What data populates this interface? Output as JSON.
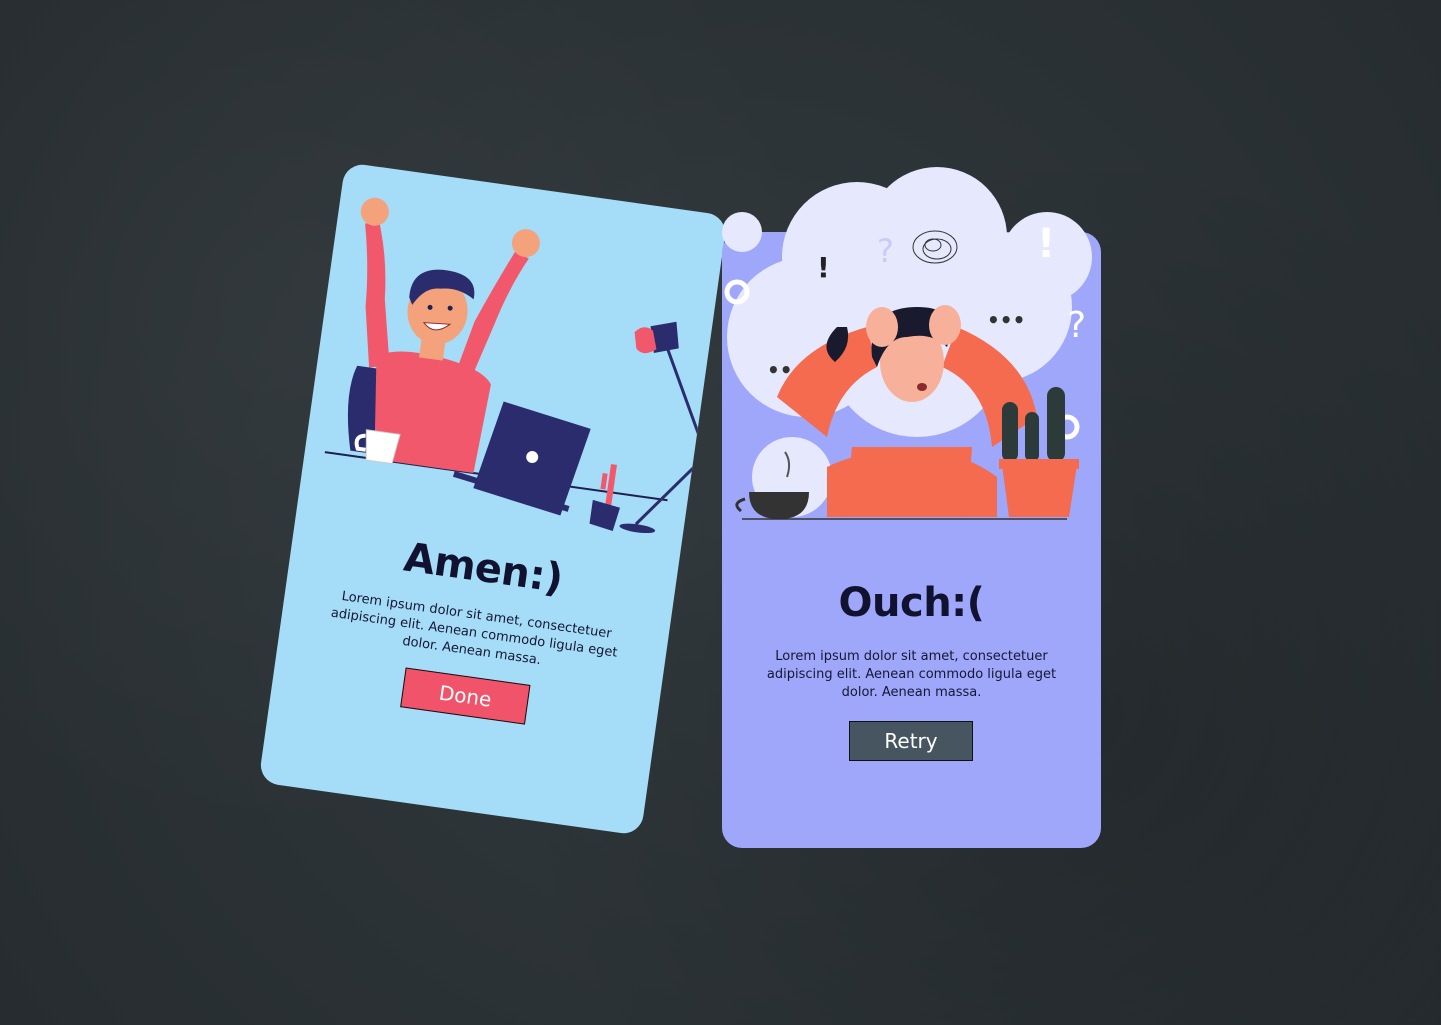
{
  "cards": {
    "success": {
      "title": "Amen:)",
      "description": "Lorem ipsum dolor sit amet, consectetuer adipiscing elit. Aenean commodo ligula eget dolor. Aenean massa.",
      "button_label": "Done",
      "colors": {
        "background": "#a5dcf7",
        "button": "#f1546a"
      }
    },
    "fail": {
      "title": "Ouch:(",
      "description": "Lorem ipsum dolor sit amet, consectetuer adipiscing elit. Aenean commodo ligula eget dolor. Aenean massa.",
      "button_label": "Retry",
      "colors": {
        "background": "#9fa7fb",
        "button": "#475561"
      }
    }
  },
  "icons": [
    "celebrating-person-illustration",
    "laptop-icon",
    "desk-lamp-icon",
    "coffee-cup-icon",
    "cactus-icon",
    "stressed-person-illustration",
    "thought-cloud-icon",
    "question-mark-icon",
    "exclamation-icon",
    "gear-icon"
  ]
}
